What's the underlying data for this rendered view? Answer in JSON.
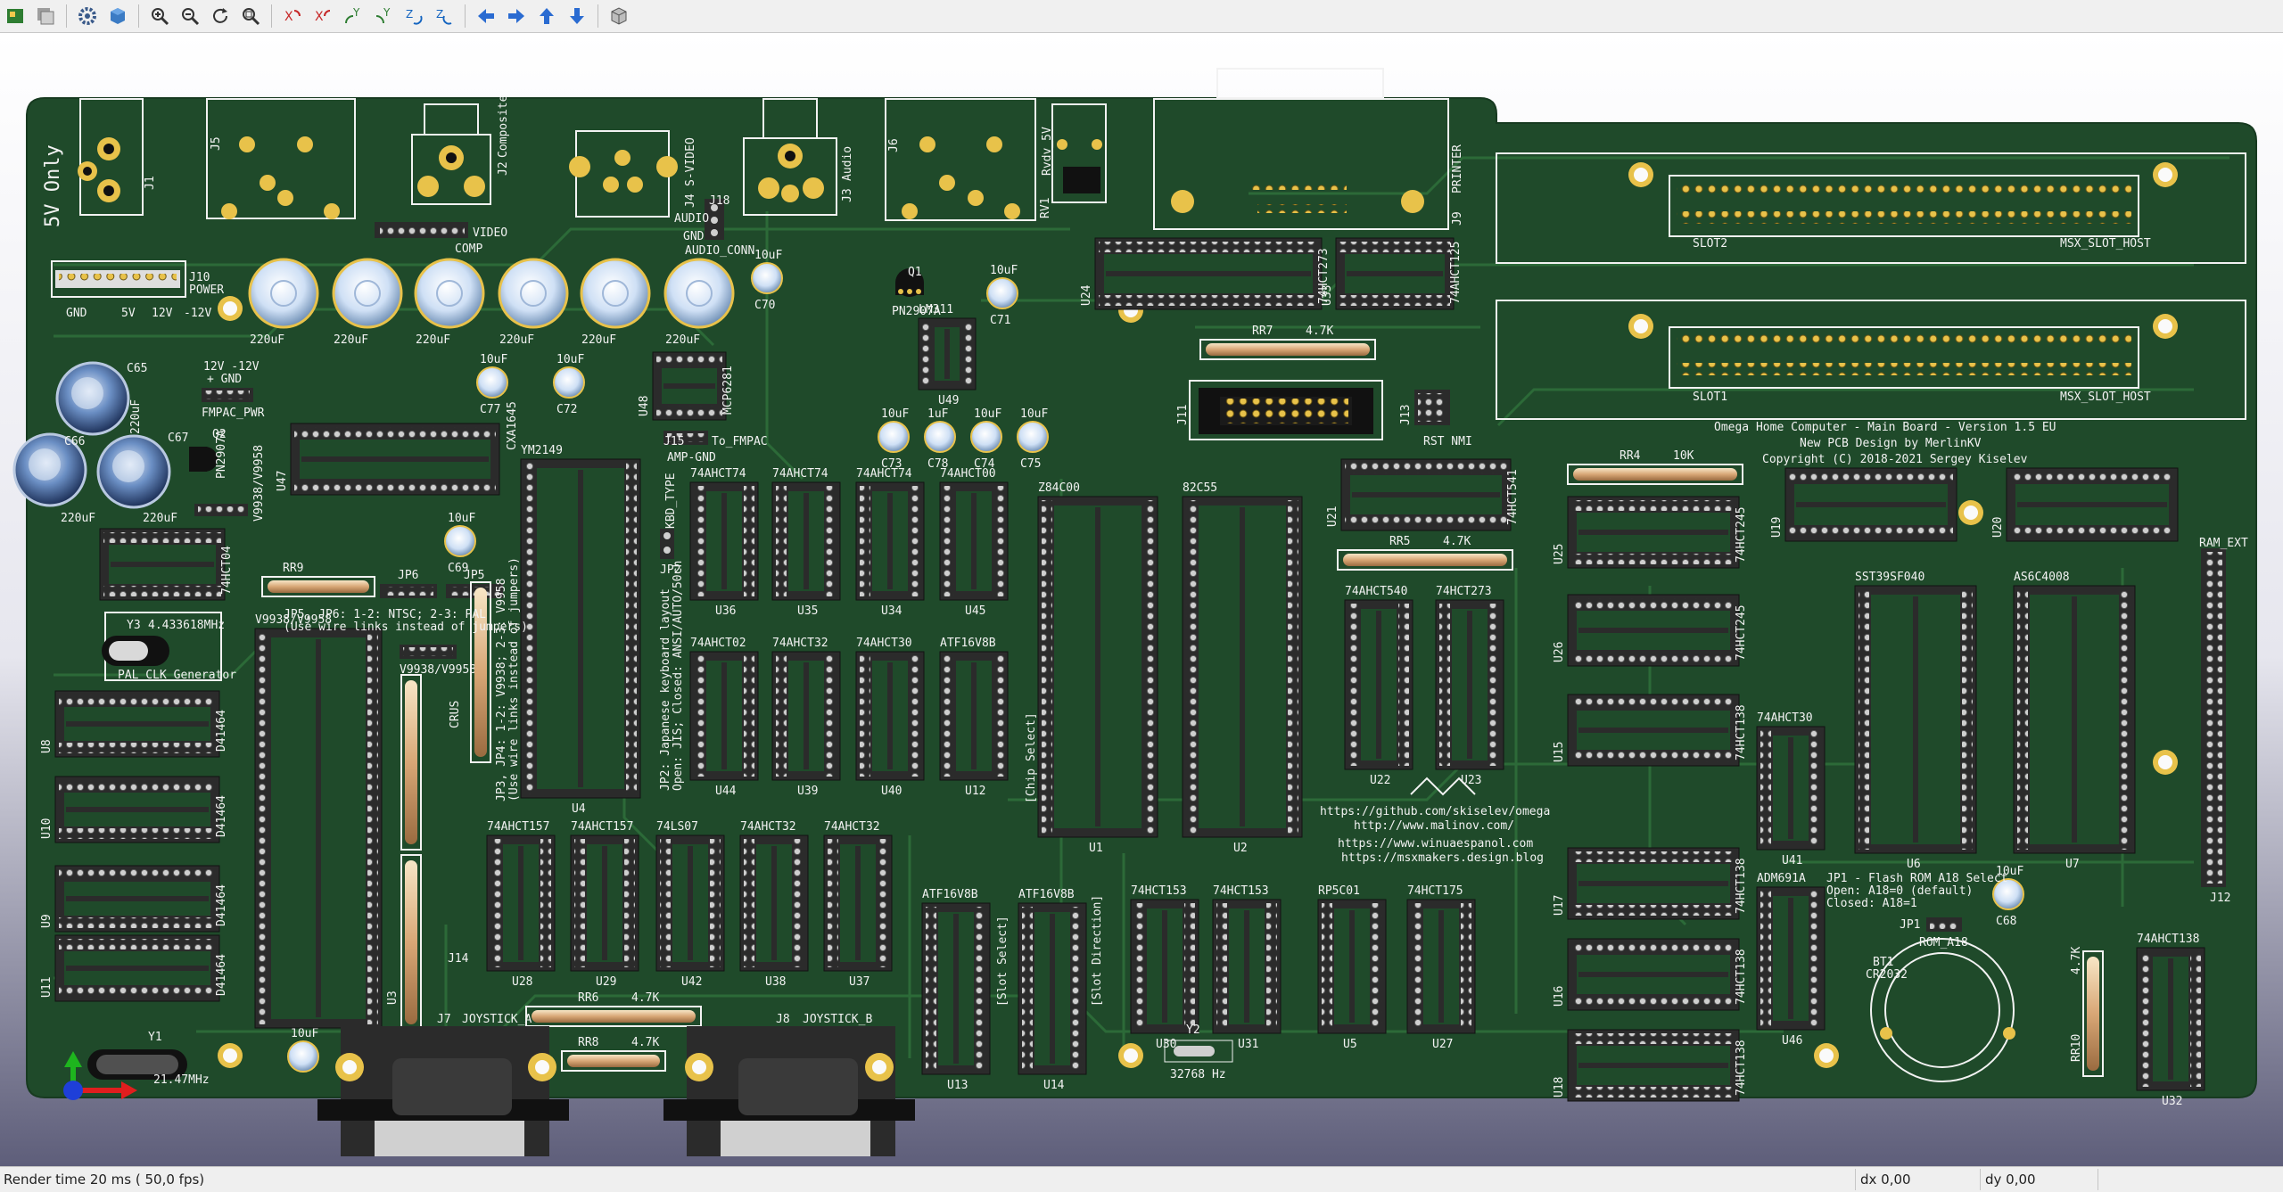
{
  "toolbar": {
    "buttons": [
      {
        "name": "layers-icon",
        "title": "Layers"
      },
      {
        "name": "drawings-icon",
        "title": "Drawings"
      },
      {
        "name": "gear-icon",
        "title": "Preferences"
      },
      {
        "name": "board-3d-icon",
        "title": "3D Board"
      },
      {
        "name": "zoom-in-icon",
        "title": "Zoom in"
      },
      {
        "name": "zoom-out-icon",
        "title": "Zoom out"
      },
      {
        "name": "refresh-icon",
        "title": "Redraw"
      },
      {
        "name": "zoom-fit-icon",
        "title": "Zoom to fit"
      },
      {
        "name": "rotate-x-cw-icon",
        "title": "Rotate X CW"
      },
      {
        "name": "rotate-x-ccw-icon",
        "title": "Rotate X CCW"
      },
      {
        "name": "rotate-y-cw-icon",
        "title": "Rotate Y CW"
      },
      {
        "name": "rotate-y-ccw-icon",
        "title": "Rotate Y CCW"
      },
      {
        "name": "rotate-z-cw-icon",
        "title": "Rotate Z CW"
      },
      {
        "name": "rotate-z-ccw-icon",
        "title": "Rotate Z CCW"
      },
      {
        "name": "arrow-left-icon",
        "title": "Move left"
      },
      {
        "name": "arrow-right-icon",
        "title": "Move right"
      },
      {
        "name": "arrow-up-icon",
        "title": "Move up"
      },
      {
        "name": "arrow-down-icon",
        "title": "Move down"
      },
      {
        "name": "ortho-cube-icon",
        "title": "Orthographic"
      }
    ]
  },
  "status": {
    "render_time": "Render time 20 ms ( 50,0 fps)",
    "dx": "dx 0,00",
    "dy": "dy 0,00"
  },
  "colors": {
    "pcb": "#1f4a2a",
    "pcb_dark": "#173a20",
    "trace": "#2c6a38",
    "silk": "#f2f2f2",
    "pad": "#e8c24a",
    "socket": "#2b2b2b",
    "pin": "#cfcfcf",
    "cap": "#dfe9f5",
    "background_top": "#ffffff",
    "background_bottom": "#5e5e7a"
  },
  "board": {
    "five_v_only": "5V Only",
    "title_lines": [
      "Omega Home Computer - Main Board - Version 1.5 EU",
      "New PCB Design by MerlinKV",
      "Copyright (C) 2018-2021 Sergey Kiselev"
    ],
    "urls": [
      "https://github.com/skiselev/omega",
      "http://www.malinov.com/",
      "https://www.winuaespanol.com",
      "https://msxmakers.design.blog"
    ],
    "texts": {
      "j10": "J10",
      "power": "POWER",
      "gnd": "GND",
      "v5": "5V",
      "v12": "12V",
      "vm12": "-12V",
      "cap220": "220uF",
      "cap10": "10uF",
      "cap1": "1uF",
      "c65": "C65",
      "c66": "C66",
      "c67": "C67",
      "c70": "C70",
      "c71": "C71",
      "c72": "C72",
      "c77": "C77",
      "c69": "C69",
      "c68": "C68",
      "c73": "C73",
      "c78": "C78",
      "c74": "C74",
      "c75": "C75",
      "fmpac_pwr": "FMPAC_PWR",
      "v12m12": "12V -12V",
      "gnd2": "+ GND",
      "q1": "Q1",
      "pn2907a": "PN2907A",
      "pn2907a_b": "PN2907A",
      "q2": "Q2",
      "v9938": "V9938/V9958",
      "v9938b": "V9938/V9958",
      "ym2149": "YM2149",
      "cxa1645": "CXA1645",
      "j1": "J1",
      "j5": "J5",
      "j2": "J2",
      "composite": "Composite",
      "j4": "J4",
      "svideo": "S-VIDEO",
      "j3": "J3",
      "audio": "Audio",
      "j6": "J6",
      "rv1": "RV1",
      "rvdv": "Rvdv_5V",
      "j9": "J9",
      "printer": "PRINTER",
      "video": "VIDEO",
      "comp": "COMP",
      "j18": "J18",
      "audio2": "AUDIO",
      "audio_conn": "AUDIO_CONN",
      "gnd3": "GND",
      "mcp": "MCP6281",
      "u48": "U48",
      "lm311": "LM311",
      "u49": "U49",
      "to_fmpac": "To_FMPAC",
      "amp_gnd": "AMP-GND",
      "j15": "J15",
      "kbd_type": "KBD_TYPE",
      "jp2": "JP2",
      "jp2_text": "JP2: Japanese keyboard layout",
      "jp2_text2": "Open: JIS; Closed: ANSI/AUTO/50ch",
      "jp3_text": "JP3, JP4: 1-2: V9938; 2-3: V9958",
      "jp3_text2": "(Use wire links instead of jumpers)",
      "jp56_text": "JP5, JP6: 1-2: NTSC; 2-3: PAL",
      "jp56_text2": "(Use wire links instead of jumpers)",
      "rr9": "RR9",
      "jp6": "JP6",
      "jp5": "JP5",
      "rr7": "RR7",
      "r47k": "4.7K",
      "rr4": "RR4",
      "r10k": "10K",
      "rr5": "RR5",
      "rr6": "RR6",
      "rr8": "RR8",
      "rr10": "RR10",
      "y3": "Y3",
      "y3f": "4.433618MHz",
      "pal_clk": "PAL CLK Generator",
      "y1": "Y1",
      "y1f": "21.47MHz",
      "y2": "Y2",
      "y2f": "32768 Hz",
      "slot1": "SLOT1",
      "slot2": "SLOT2",
      "msx_slot": "MSX_SLOT_HOST",
      "msx_slot2": "MSX_SLOT_HOST",
      "j11": "J11",
      "j13": "J13",
      "rst_nmi": "RST NMI",
      "ram_ext": "RAM_EXT",
      "j12": "J12",
      "sst": "SST39SF040",
      "as6c": "AS6C4008",
      "u6": "U6",
      "u7": "U7",
      "jp1_text": "JP1 - Flash ROM A18 Select",
      "jp1_text2": "Open: A18=0 (default)",
      "jp1_text3": "Closed: A18=1",
      "jp1": "JP1",
      "rom_a18": "ROM_A18",
      "bt1": "BT1",
      "cr2032": "CR2032",
      "j7": "J7",
      "joystick_a": "JOYSTICK_A",
      "j8": "J8",
      "joystick_b": "JOYSTICK_B",
      "z84c00": "Z84C00",
      "c82c55": "82C55",
      "u1": "U1",
      "u2": "U2",
      "chip_select": "[Chip Select]",
      "slot_select": "[Slot Select]",
      "slot_dir": "[Slot Direction]",
      "crus": "CRUS",
      "u3": "U3",
      "u4": "U4",
      "u8": "U8",
      "u10": "U10",
      "u9": "U9",
      "u11": "U11",
      "d41": "D41464",
      "j14": "J14",
      "rom": "ROM",
      "u24": "U24",
      "u31": "U31",
      "u21": "U21",
      "u27": "U27",
      "u32": "U32",
      "u41": "U41",
      "u46": "U46",
      "u47": "U47"
    },
    "ic_labels": {
      "row1": [
        "74AHCT74",
        "74AHCT74",
        "74AHCT74",
        "74AHCT00"
      ],
      "row1_u": [
        "U36",
        "U35",
        "U34",
        "U45"
      ],
      "row2": [
        "74AHCT02",
        "74AHCT32",
        "74AHCT30",
        "ATF16V8B"
      ],
      "row2_u": [
        "U44",
        "U39",
        "U40",
        "U12"
      ],
      "row3": [
        "74AHCT157",
        "74AHCT157",
        "74LS07",
        "74AHCT32",
        "74AHCT32"
      ],
      "row3_u": [
        "U28",
        "U29",
        "U42",
        "U38",
        "U37"
      ],
      "atf_low": [
        "ATF16V8B",
        "ATF16V8B"
      ],
      "atf_low_u": [
        "U13",
        "U14"
      ],
      "row4": [
        "74HCT153",
        "74HCT153",
        "RP5C01",
        "74HCT175"
      ],
      "row4_u": [
        "U30",
        "U31",
        "U5",
        "U27"
      ],
      "mid": [
        "74AHCT540",
        "74HCT273"
      ],
      "mid_u": [
        "U22",
        "U23"
      ],
      "top": [
        "74HCT273",
        "74AHCT125"
      ],
      "top_u": [
        "U24",
        "U33"
      ],
      "right1": [
        "74HCT245",
        "74HCT245",
        "74HCT138",
        "74HCT138",
        "74HCT138",
        "74HCT138"
      ],
      "right1_u": [
        "U25",
        "U26",
        "U15",
        "U17",
        "U16",
        "U18"
      ],
      "ahct30": "74AHCT30",
      "adm691a": "ADM691A",
      "ahct138": "74AHCT138",
      "ls04": "74HCT04",
      "hct541": "74HCT541",
      "u19": "U19",
      "u20": "U20"
    }
  }
}
